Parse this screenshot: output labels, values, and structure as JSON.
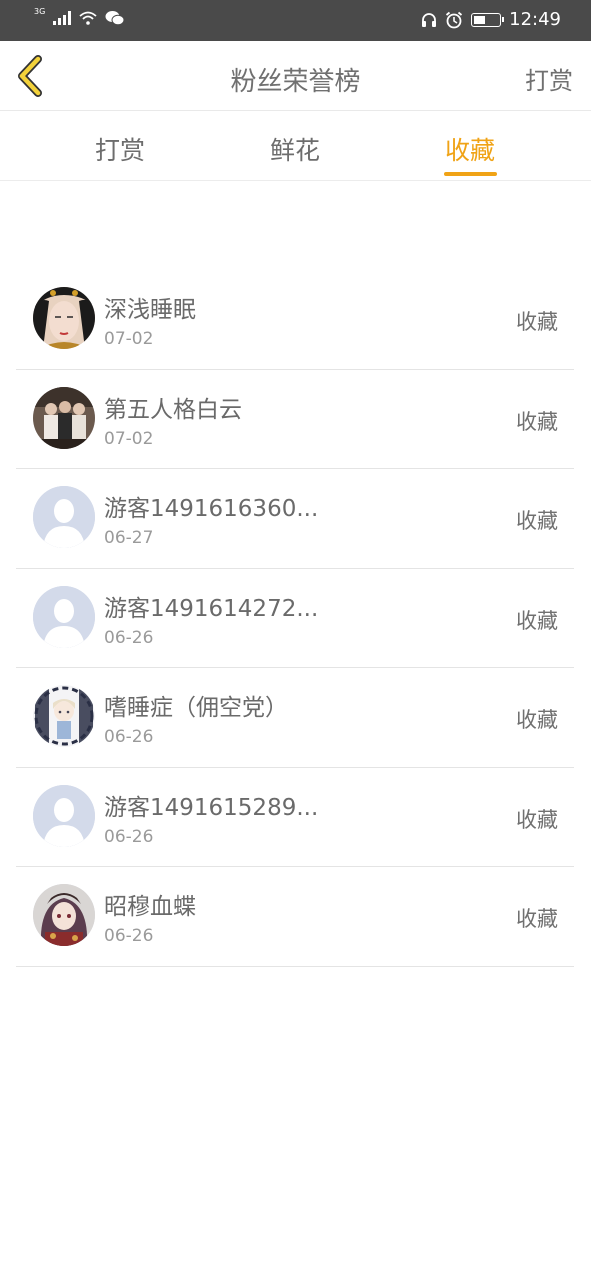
{
  "status_bar": {
    "network": "3G",
    "time": "12:49",
    "battery_level": 0.4
  },
  "header": {
    "title": "粉丝荣誉榜",
    "action_label": "打赏",
    "accent_color": "#f0a316"
  },
  "tabs": [
    {
      "label": "打赏",
      "active": false
    },
    {
      "label": "鲜花",
      "active": false
    },
    {
      "label": "收藏",
      "active": true
    }
  ],
  "list": [
    {
      "name": "深浅睡眠",
      "date": "07-02",
      "kind": "收藏",
      "avatar": "portrait-avatar"
    },
    {
      "name": "第五人格白云",
      "date": "07-02",
      "kind": "收藏",
      "avatar": "group-photo-avatar"
    },
    {
      "name": "游客1491616360...",
      "date": "06-27",
      "kind": "收藏",
      "avatar": "default-avatar"
    },
    {
      "name": "游客1491614272...",
      "date": "06-26",
      "kind": "收藏",
      "avatar": "default-avatar"
    },
    {
      "name": "嗜睡症（佣空党）",
      "date": "06-26",
      "kind": "收藏",
      "avatar": "anime-avatar"
    },
    {
      "name": "游客1491615289...",
      "date": "06-26",
      "kind": "收藏",
      "avatar": "default-avatar"
    },
    {
      "name": "昭穆血蝶",
      "date": "06-26",
      "kind": "收藏",
      "avatar": "anime-girl-avatar"
    }
  ]
}
